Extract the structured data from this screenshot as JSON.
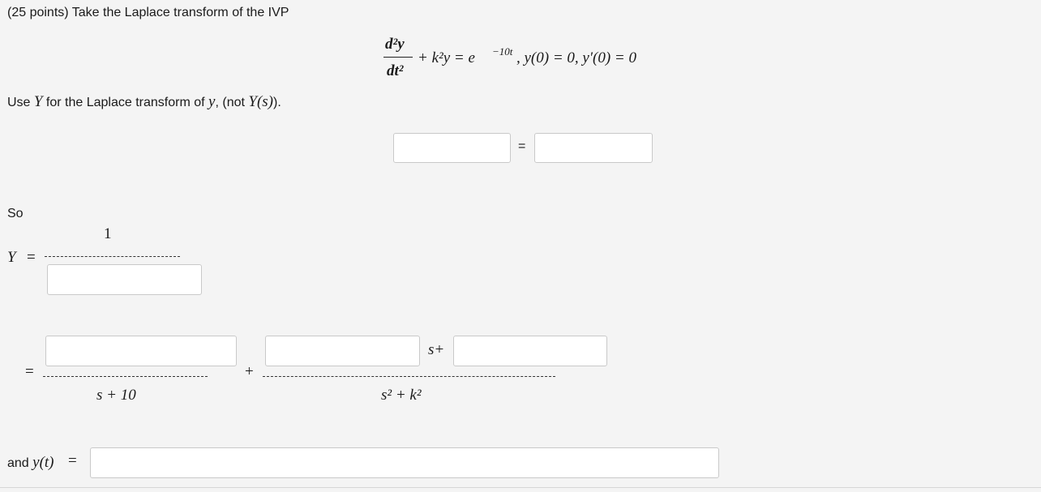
{
  "problem": {
    "header": "(25 points) Take the Laplace transform of the IVP",
    "instruction_pre": "Use ",
    "instruction_Y": "Y",
    "instruction_mid": " for the Laplace transform of ",
    "instruction_y": "y",
    "instruction_post": ", (not ",
    "instruction_Ys": "Y(s)",
    "instruction_end": ")."
  },
  "equation": {
    "numerator": "d²y",
    "denominator": "dt²",
    "rest_pre": "+ k²y = e",
    "exponent": "−10t",
    "rest_post": ", y(0) = 0, y′(0) = 0"
  },
  "transform_row": {
    "equals": "=",
    "left_value": "",
    "right_value": ""
  },
  "solution": {
    "so_label": "So",
    "Y_label": "Y",
    "Y_equals": "=",
    "fraction1_numerator": "1",
    "fraction1_denominator_value": "",
    "equals2": "=",
    "partial1_numerator_value": "",
    "partial1_denominator": "s + 10",
    "plus": "+",
    "partial2_coef_value": "",
    "partial2_s_plus": "s+",
    "partial2_const_value": "",
    "partial2_denominator": "s² + k²"
  },
  "final": {
    "label_and": "and ",
    "label_yt": "y(t)",
    "label_eq": "=",
    "value": ""
  }
}
